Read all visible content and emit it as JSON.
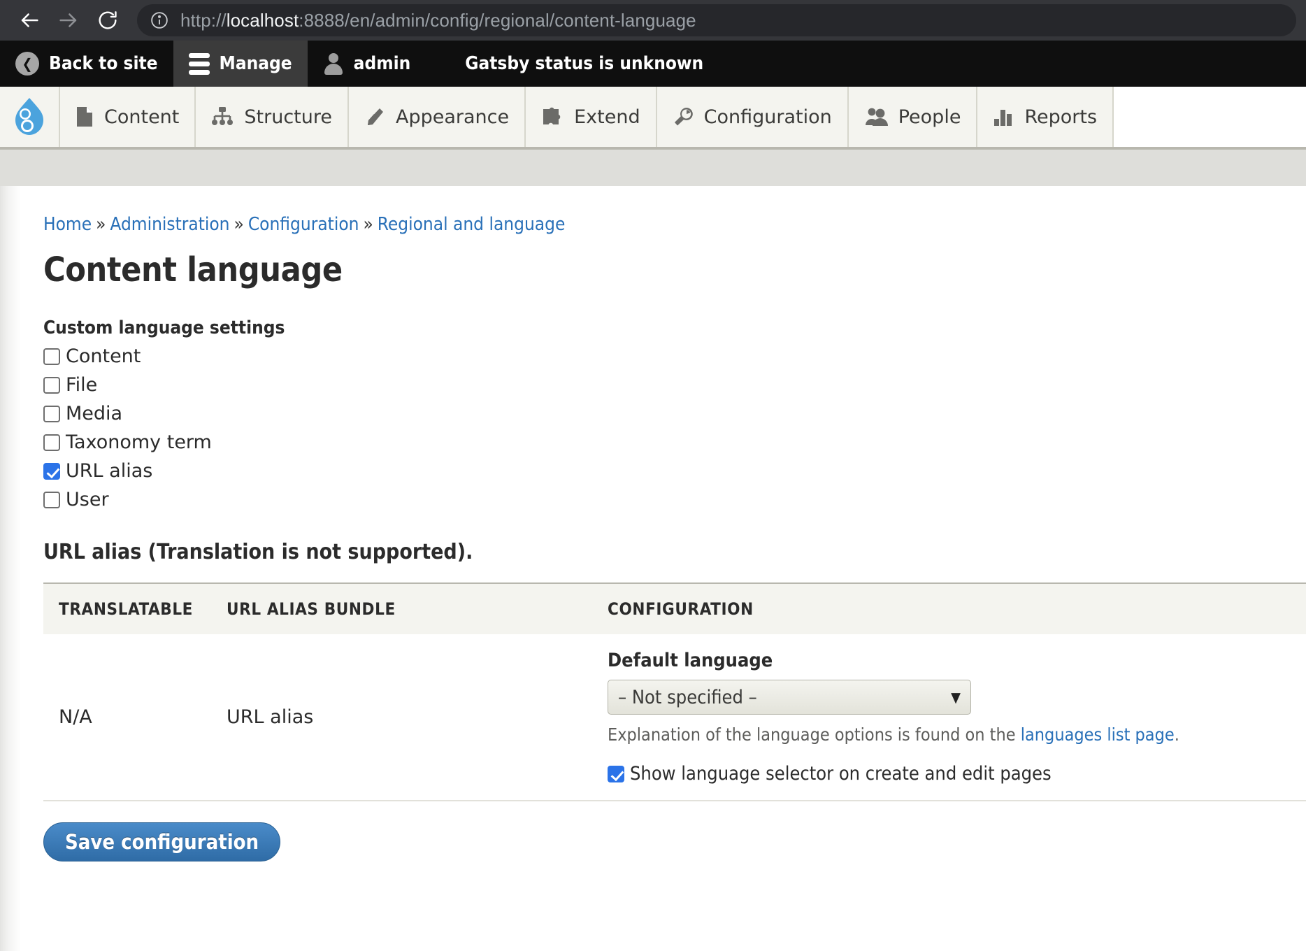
{
  "browser": {
    "back_icon": "back-arrow-icon",
    "forward_icon": "forward-arrow-icon",
    "reload_icon": "reload-icon",
    "info_icon": "info-icon",
    "url_scheme": "http://",
    "url_host": "localhost",
    "url_rest": ":8888/en/admin/config/regional/content-language",
    "url_full": "http://localhost:8888/en/admin/config/regional/content-language"
  },
  "admin_toolbar": {
    "back_to_site": "Back to site",
    "manage": "Manage",
    "user": "admin",
    "status": "Gatsby status is unknown"
  },
  "admin_menu": {
    "logo": "drupal-logo",
    "items": [
      {
        "label": "Content",
        "icon": "document-icon"
      },
      {
        "label": "Structure",
        "icon": "sitemap-icon"
      },
      {
        "label": "Appearance",
        "icon": "paintbrush-icon"
      },
      {
        "label": "Extend",
        "icon": "puzzle-piece-icon"
      },
      {
        "label": "Configuration",
        "icon": "wrench-icon"
      },
      {
        "label": "People",
        "icon": "people-icon"
      },
      {
        "label": "Reports",
        "icon": "bar-chart-icon"
      }
    ]
  },
  "breadcrumb": {
    "items": [
      "Home",
      "Administration",
      "Configuration",
      "Regional and language"
    ],
    "separator": "»"
  },
  "page": {
    "title": "Content language",
    "custom_settings_label": "Custom language settings",
    "entity_checkboxes": [
      {
        "label": "Content",
        "checked": false
      },
      {
        "label": "File",
        "checked": false
      },
      {
        "label": "Media",
        "checked": false
      },
      {
        "label": "Taxonomy term",
        "checked": false
      },
      {
        "label": "URL alias",
        "checked": true
      },
      {
        "label": "User",
        "checked": false
      }
    ],
    "sub_heading": "URL alias (Translation is not supported).",
    "table": {
      "headers": [
        "TRANSLATABLE",
        "URL ALIAS BUNDLE",
        "CONFIGURATION"
      ],
      "rows": [
        {
          "translatable": "N/A",
          "bundle": "URL alias",
          "configuration": {
            "default_language_label": "Default language",
            "default_language_value": "– Not specified –",
            "caret": "▼",
            "description_prefix": "Explanation of the language options is found on the ",
            "description_link": "languages list page",
            "description_suffix": ".",
            "show_selector_label": "Show language selector on create and edit pages",
            "show_selector_checked": true
          }
        }
      ]
    },
    "save_button": "Save configuration"
  },
  "colors": {
    "accent_blue": "#2970b8",
    "checkbox_blue": "#2b73e8",
    "button_blue": "#2f6ca6",
    "toolbar_black": "#0f0f0f",
    "menu_bg": "#f4f4ef",
    "band_gray": "#dededa"
  }
}
